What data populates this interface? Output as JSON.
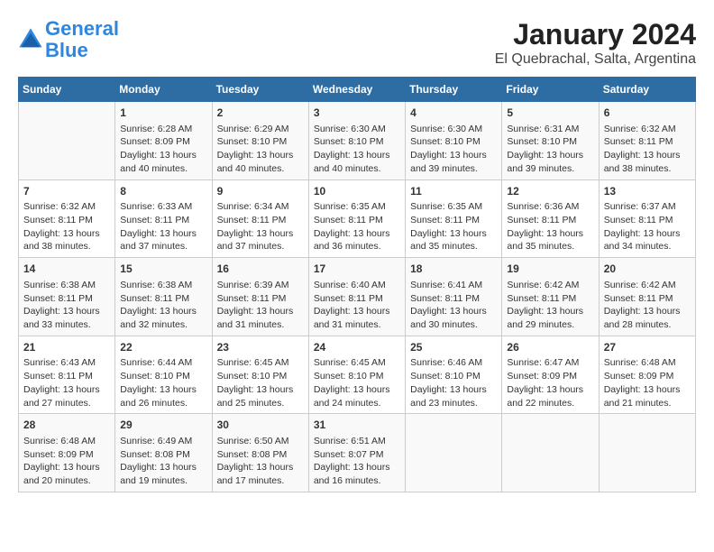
{
  "header": {
    "logo_line1": "General",
    "logo_line2": "Blue",
    "title": "January 2024",
    "subtitle": "El Quebrachal, Salta, Argentina"
  },
  "weekdays": [
    "Sunday",
    "Monday",
    "Tuesday",
    "Wednesday",
    "Thursday",
    "Friday",
    "Saturday"
  ],
  "weeks": [
    [
      {
        "day": "",
        "info": ""
      },
      {
        "day": "1",
        "info": "Sunrise: 6:28 AM\nSunset: 8:09 PM\nDaylight: 13 hours\nand 40 minutes."
      },
      {
        "day": "2",
        "info": "Sunrise: 6:29 AM\nSunset: 8:10 PM\nDaylight: 13 hours\nand 40 minutes."
      },
      {
        "day": "3",
        "info": "Sunrise: 6:30 AM\nSunset: 8:10 PM\nDaylight: 13 hours\nand 40 minutes."
      },
      {
        "day": "4",
        "info": "Sunrise: 6:30 AM\nSunset: 8:10 PM\nDaylight: 13 hours\nand 39 minutes."
      },
      {
        "day": "5",
        "info": "Sunrise: 6:31 AM\nSunset: 8:10 PM\nDaylight: 13 hours\nand 39 minutes."
      },
      {
        "day": "6",
        "info": "Sunrise: 6:32 AM\nSunset: 8:11 PM\nDaylight: 13 hours\nand 38 minutes."
      }
    ],
    [
      {
        "day": "7",
        "info": "Sunrise: 6:32 AM\nSunset: 8:11 PM\nDaylight: 13 hours\nand 38 minutes."
      },
      {
        "day": "8",
        "info": "Sunrise: 6:33 AM\nSunset: 8:11 PM\nDaylight: 13 hours\nand 37 minutes."
      },
      {
        "day": "9",
        "info": "Sunrise: 6:34 AM\nSunset: 8:11 PM\nDaylight: 13 hours\nand 37 minutes."
      },
      {
        "day": "10",
        "info": "Sunrise: 6:35 AM\nSunset: 8:11 PM\nDaylight: 13 hours\nand 36 minutes."
      },
      {
        "day": "11",
        "info": "Sunrise: 6:35 AM\nSunset: 8:11 PM\nDaylight: 13 hours\nand 35 minutes."
      },
      {
        "day": "12",
        "info": "Sunrise: 6:36 AM\nSunset: 8:11 PM\nDaylight: 13 hours\nand 35 minutes."
      },
      {
        "day": "13",
        "info": "Sunrise: 6:37 AM\nSunset: 8:11 PM\nDaylight: 13 hours\nand 34 minutes."
      }
    ],
    [
      {
        "day": "14",
        "info": "Sunrise: 6:38 AM\nSunset: 8:11 PM\nDaylight: 13 hours\nand 33 minutes."
      },
      {
        "day": "15",
        "info": "Sunrise: 6:38 AM\nSunset: 8:11 PM\nDaylight: 13 hours\nand 32 minutes."
      },
      {
        "day": "16",
        "info": "Sunrise: 6:39 AM\nSunset: 8:11 PM\nDaylight: 13 hours\nand 31 minutes."
      },
      {
        "day": "17",
        "info": "Sunrise: 6:40 AM\nSunset: 8:11 PM\nDaylight: 13 hours\nand 31 minutes."
      },
      {
        "day": "18",
        "info": "Sunrise: 6:41 AM\nSunset: 8:11 PM\nDaylight: 13 hours\nand 30 minutes."
      },
      {
        "day": "19",
        "info": "Sunrise: 6:42 AM\nSunset: 8:11 PM\nDaylight: 13 hours\nand 29 minutes."
      },
      {
        "day": "20",
        "info": "Sunrise: 6:42 AM\nSunset: 8:11 PM\nDaylight: 13 hours\nand 28 minutes."
      }
    ],
    [
      {
        "day": "21",
        "info": "Sunrise: 6:43 AM\nSunset: 8:11 PM\nDaylight: 13 hours\nand 27 minutes."
      },
      {
        "day": "22",
        "info": "Sunrise: 6:44 AM\nSunset: 8:10 PM\nDaylight: 13 hours\nand 26 minutes."
      },
      {
        "day": "23",
        "info": "Sunrise: 6:45 AM\nSunset: 8:10 PM\nDaylight: 13 hours\nand 25 minutes."
      },
      {
        "day": "24",
        "info": "Sunrise: 6:45 AM\nSunset: 8:10 PM\nDaylight: 13 hours\nand 24 minutes."
      },
      {
        "day": "25",
        "info": "Sunrise: 6:46 AM\nSunset: 8:10 PM\nDaylight: 13 hours\nand 23 minutes."
      },
      {
        "day": "26",
        "info": "Sunrise: 6:47 AM\nSunset: 8:09 PM\nDaylight: 13 hours\nand 22 minutes."
      },
      {
        "day": "27",
        "info": "Sunrise: 6:48 AM\nSunset: 8:09 PM\nDaylight: 13 hours\nand 21 minutes."
      }
    ],
    [
      {
        "day": "28",
        "info": "Sunrise: 6:48 AM\nSunset: 8:09 PM\nDaylight: 13 hours\nand 20 minutes."
      },
      {
        "day": "29",
        "info": "Sunrise: 6:49 AM\nSunset: 8:08 PM\nDaylight: 13 hours\nand 19 minutes."
      },
      {
        "day": "30",
        "info": "Sunrise: 6:50 AM\nSunset: 8:08 PM\nDaylight: 13 hours\nand 17 minutes."
      },
      {
        "day": "31",
        "info": "Sunrise: 6:51 AM\nSunset: 8:07 PM\nDaylight: 13 hours\nand 16 minutes."
      },
      {
        "day": "",
        "info": ""
      },
      {
        "day": "",
        "info": ""
      },
      {
        "day": "",
        "info": ""
      }
    ]
  ]
}
